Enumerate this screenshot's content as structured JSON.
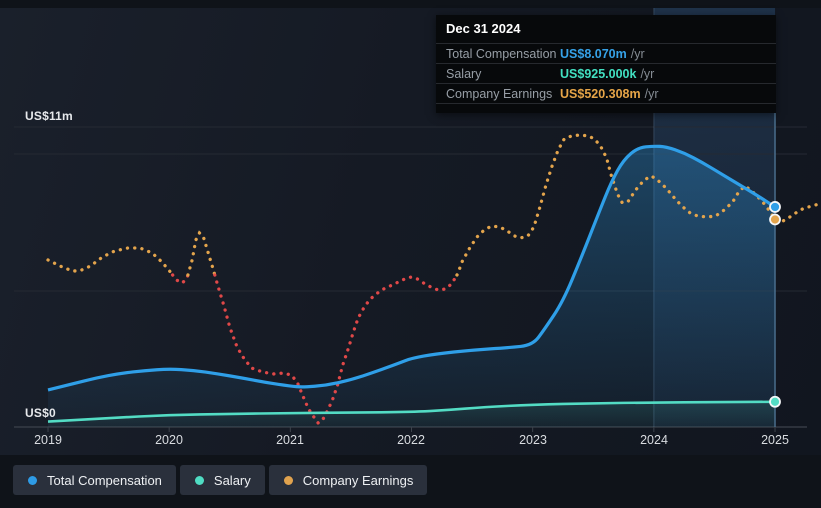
{
  "tooltip": {
    "date": "Dec 31 2024",
    "rows": [
      {
        "label": "Total Compensation",
        "value": "US$8.070m",
        "suffix": "/yr",
        "color": "#36a2e8"
      },
      {
        "label": "Salary",
        "value": "US$925.000k",
        "suffix": "/yr",
        "color": "#42e0c2"
      },
      {
        "label": "Company Earnings",
        "value": "US$520.308m",
        "suffix": "/yr",
        "color": "#e6a548"
      }
    ]
  },
  "axis": {
    "y_top_label": "US$11m",
    "y_zero_label": "US$0",
    "x_labels": [
      "2019",
      "2020",
      "2021",
      "2022",
      "2023",
      "2024",
      "2025"
    ]
  },
  "legend": [
    {
      "label": "Total Compensation",
      "color": "#2e9be6"
    },
    {
      "label": "Salary",
      "color": "#4fdcc3"
    },
    {
      "label": "Company Earnings",
      "color": "#e0a24e"
    }
  ],
  "chart_data": {
    "type": "line",
    "title": "Executive compensation vs company earnings over time",
    "x_axis": {
      "tick_labels": [
        "2019",
        "2020",
        "2021",
        "2022",
        "2023",
        "2024",
        "2025"
      ],
      "range": [
        2019,
        2025.37
      ]
    },
    "y_axis": {
      "unit": "US$ millions / yr",
      "range": [
        0,
        11
      ],
      "top_label": "US$11m",
      "zero_label": "US$0",
      "gridlines_musd": [
        0,
        5,
        10,
        11
      ]
    },
    "legend_position": "bottom-left",
    "grid": true,
    "highlight_band_years": [
      2024,
      2025
    ],
    "hover_marker_year": 2025.0,
    "series": [
      {
        "name": "Total Compensation",
        "color": "#2f9fe8",
        "style": "solid",
        "area_fill": true,
        "unit": "US$m/yr",
        "points": [
          [
            2019.0,
            1.36
          ],
          [
            2019.2,
            1.58
          ],
          [
            2019.4,
            1.8
          ],
          [
            2019.6,
            1.97
          ],
          [
            2019.8,
            2.07
          ],
          [
            2020.0,
            2.13
          ],
          [
            2020.2,
            2.08
          ],
          [
            2020.4,
            1.95
          ],
          [
            2020.6,
            1.8
          ],
          [
            2020.8,
            1.63
          ],
          [
            2021.0,
            1.5
          ],
          [
            2021.1,
            1.46
          ],
          [
            2021.3,
            1.53
          ],
          [
            2021.5,
            1.73
          ],
          [
            2021.7,
            2.02
          ],
          [
            2021.9,
            2.35
          ],
          [
            2022.0,
            2.52
          ],
          [
            2022.2,
            2.68
          ],
          [
            2022.5,
            2.82
          ],
          [
            2022.8,
            2.91
          ],
          [
            2023.0,
            3.0
          ],
          [
            2023.1,
            3.6
          ],
          [
            2023.25,
            4.6
          ],
          [
            2023.4,
            6.2
          ],
          [
            2023.55,
            7.9
          ],
          [
            2023.65,
            9.0
          ],
          [
            2023.75,
            9.8
          ],
          [
            2023.87,
            10.25
          ],
          [
            2024.0,
            10.3
          ],
          [
            2024.1,
            10.28
          ],
          [
            2024.25,
            10.05
          ],
          [
            2024.4,
            9.7
          ],
          [
            2024.55,
            9.3
          ],
          [
            2024.7,
            8.9
          ],
          [
            2024.85,
            8.5
          ],
          [
            2025.0,
            8.07
          ]
        ]
      },
      {
        "name": "Salary",
        "color": "#53dcc4",
        "style": "solid",
        "area_fill": true,
        "unit": "US$m/yr",
        "points": [
          [
            2019.0,
            0.2
          ],
          [
            2019.5,
            0.33
          ],
          [
            2020.0,
            0.44
          ],
          [
            2020.5,
            0.48
          ],
          [
            2021.0,
            0.51
          ],
          [
            2021.5,
            0.53
          ],
          [
            2022.0,
            0.55
          ],
          [
            2022.3,
            0.62
          ],
          [
            2022.6,
            0.73
          ],
          [
            2023.0,
            0.82
          ],
          [
            2023.5,
            0.87
          ],
          [
            2024.0,
            0.9
          ],
          [
            2024.5,
            0.91
          ],
          [
            2025.0,
            0.925
          ]
        ]
      },
      {
        "name": "Company Earnings",
        "color": "#e3a44c",
        "negative_color": "#e04848",
        "style": "dotted",
        "unit": "US$m/yr",
        "axis": "hidden-earnings-scale",
        "points": [
          [
            2019.0,
            141
          ],
          [
            2019.1,
            84
          ],
          [
            2019.2,
            38
          ],
          [
            2019.26,
            38
          ],
          [
            2019.35,
            84
          ],
          [
            2019.45,
            169
          ],
          [
            2019.55,
            225
          ],
          [
            2019.66,
            253
          ],
          [
            2019.76,
            253
          ],
          [
            2019.86,
            206
          ],
          [
            2019.94,
            122
          ],
          [
            2020.01,
            28
          ],
          [
            2020.06,
            -47
          ],
          [
            2020.11,
            -75
          ],
          [
            2020.15,
            -19
          ],
          [
            2020.19,
            141
          ],
          [
            2020.22,
            328
          ],
          [
            2020.25,
            394
          ],
          [
            2020.28,
            366
          ],
          [
            2020.32,
            216
          ],
          [
            2020.36,
            66
          ],
          [
            2020.4,
            -94
          ],
          [
            2020.45,
            -281
          ],
          [
            2020.5,
            -488
          ],
          [
            2020.56,
            -675
          ],
          [
            2020.62,
            -788
          ],
          [
            2020.68,
            -872
          ],
          [
            2020.77,
            -909
          ],
          [
            2020.86,
            -928
          ],
          [
            2020.94,
            -919
          ],
          [
            2021.01,
            -938
          ],
          [
            2021.06,
            -1013
          ],
          [
            2021.1,
            -1125
          ],
          [
            2021.15,
            -1256
          ],
          [
            2021.2,
            -1341
          ],
          [
            2021.23,
            -1388
          ],
          [
            2021.27,
            -1350
          ],
          [
            2021.31,
            -1266
          ],
          [
            2021.35,
            -1163
          ],
          [
            2021.39,
            -1031
          ],
          [
            2021.43,
            -853
          ],
          [
            2021.48,
            -684
          ],
          [
            2021.52,
            -534
          ],
          [
            2021.56,
            -403
          ],
          [
            2021.61,
            -300
          ],
          [
            2021.66,
            -225
          ],
          [
            2021.72,
            -169
          ],
          [
            2021.77,
            -131
          ],
          [
            2021.84,
            -94
          ],
          [
            2021.91,
            -56
          ],
          [
            2021.96,
            -28
          ],
          [
            2022.0,
            -19
          ],
          [
            2022.05,
            -38
          ],
          [
            2022.1,
            -75
          ],
          [
            2022.16,
            -113
          ],
          [
            2022.22,
            -141
          ],
          [
            2022.28,
            -131
          ],
          [
            2022.33,
            -84
          ],
          [
            2022.38,
            9
          ],
          [
            2022.42,
            131
          ],
          [
            2022.48,
            253
          ],
          [
            2022.54,
            356
          ],
          [
            2022.6,
            422
          ],
          [
            2022.66,
            459
          ],
          [
            2022.73,
            450
          ],
          [
            2022.79,
            413
          ],
          [
            2022.85,
            366
          ],
          [
            2022.9,
            347
          ],
          [
            2022.96,
            366
          ],
          [
            2023.01,
            450
          ],
          [
            2023.06,
            638
          ],
          [
            2023.11,
            844
          ],
          [
            2023.16,
            1022
          ],
          [
            2023.21,
            1172
          ],
          [
            2023.26,
            1275
          ],
          [
            2023.32,
            1303
          ],
          [
            2023.39,
            1313
          ],
          [
            2023.46,
            1303
          ],
          [
            2023.51,
            1275
          ],
          [
            2023.56,
            1209
          ],
          [
            2023.61,
            1097
          ],
          [
            2023.65,
            928
          ],
          [
            2023.7,
            759
          ],
          [
            2023.74,
            675
          ],
          [
            2023.79,
            694
          ],
          [
            2023.85,
            797
          ],
          [
            2023.92,
            891
          ],
          [
            2023.98,
            928
          ],
          [
            2024.03,
            891
          ],
          [
            2024.1,
            816
          ],
          [
            2024.17,
            722
          ],
          [
            2024.23,
            647
          ],
          [
            2024.3,
            581
          ],
          [
            2024.36,
            553
          ],
          [
            2024.44,
            544
          ],
          [
            2024.51,
            553
          ],
          [
            2024.58,
            609
          ],
          [
            2024.65,
            684
          ],
          [
            2024.7,
            778
          ],
          [
            2024.75,
            834
          ],
          [
            2024.8,
            797
          ],
          [
            2024.86,
            731
          ],
          [
            2024.92,
            656
          ],
          [
            2024.96,
            591
          ],
          [
            2025.0,
            520.308
          ],
          [
            2025.05,
            497
          ],
          [
            2025.11,
            534
          ],
          [
            2025.17,
            581
          ],
          [
            2025.24,
            628
          ],
          [
            2025.31,
            647
          ],
          [
            2025.36,
            666
          ]
        ]
      }
    ],
    "markers": {
      "date": "Dec 31 2024",
      "x": 2025.0,
      "values": {
        "total_compensation_musd": 8.07,
        "salary_musd": 0.925,
        "company_earnings_musd": 520.308
      }
    }
  }
}
